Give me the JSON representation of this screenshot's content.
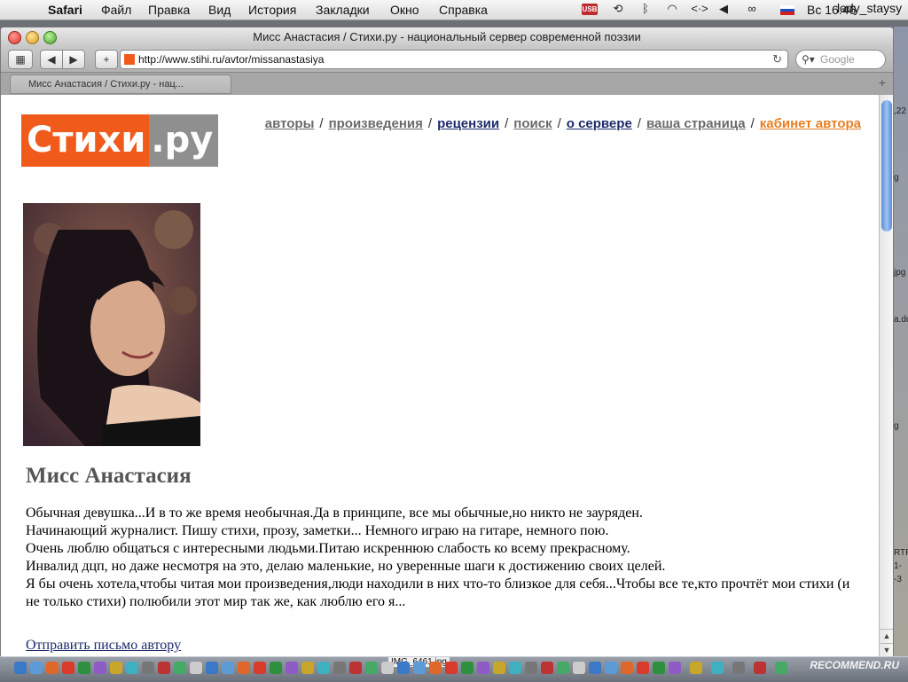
{
  "menubar": {
    "app": "Safari",
    "items": [
      "Файл",
      "Правка",
      "Вид",
      "История",
      "Закладки",
      "Окно",
      "Справка"
    ],
    "usb_label": "USB",
    "clock": "Вс 16:46",
    "user": "lady_staysy"
  },
  "window": {
    "title": "Мисс Анастасия / Стихи.ру - национальный сервер современной поэзии",
    "url": "http://www.stihi.ru/avtor/missanastasiya",
    "search_placeholder": "Google",
    "tab_label": "Мисс Анастасия / Стихи.ру - нац..."
  },
  "page": {
    "logo_main": "Стихи",
    "logo_suffix": ".ру",
    "nav": [
      {
        "label": "авторы",
        "color": "#6a6a6a"
      },
      {
        "label": "произведения",
        "color": "#6a6a6a"
      },
      {
        "label": "рецензии",
        "color": "#1d2a6b"
      },
      {
        "label": "поиск",
        "color": "#6a6a6a"
      },
      {
        "label": "о сервере",
        "color": "#1d2a6b"
      },
      {
        "label": "ваша страница",
        "color": "#6a6a6a"
      },
      {
        "label": "кабинет автора",
        "color": "#e67e22"
      }
    ],
    "nav_separator": "/",
    "author_name": "Мисс Анастасия",
    "bio": [
      "Обычная девушка...И в то же время необычная.Да в принципе, все мы обычные,но никто не зауряден.",
      "Начинающий журналист. Пишу стихи, прозу, заметки... Немного играю на гитаре, немного пою.",
      "Очень люблю общаться с интересными людьми.Питаю искреннюю слабость ко всему прекрасному.",
      "Инвалид дцп, но даже несмотря на это, делаю маленькие, но уверенные шаги к достижению своих целей.",
      "Я бы очень хотела,чтобы читая мои произведения,люди находили в них что-то близкое для себя...Чтобы все те,кто прочтёт мои стихи (и не только стихи) полюбили этот мир так же, как люблю его я..."
    ],
    "mail_link": "Отправить письмо автору"
  },
  "desktop": {
    "side_labels": [
      ",22",
      "g",
      "jpg",
      "a.dc",
      "g",
      "RTF",
      "1-",
      "-3"
    ]
  },
  "dock": {
    "file_label": "IMG_6461.jpg",
    "watermark": "RECOMMEND.RU"
  },
  "colors": {
    "brand_orange": "#f05b1c",
    "brand_grey": "#8f8f8f",
    "link_blue": "#1d2a6b"
  }
}
